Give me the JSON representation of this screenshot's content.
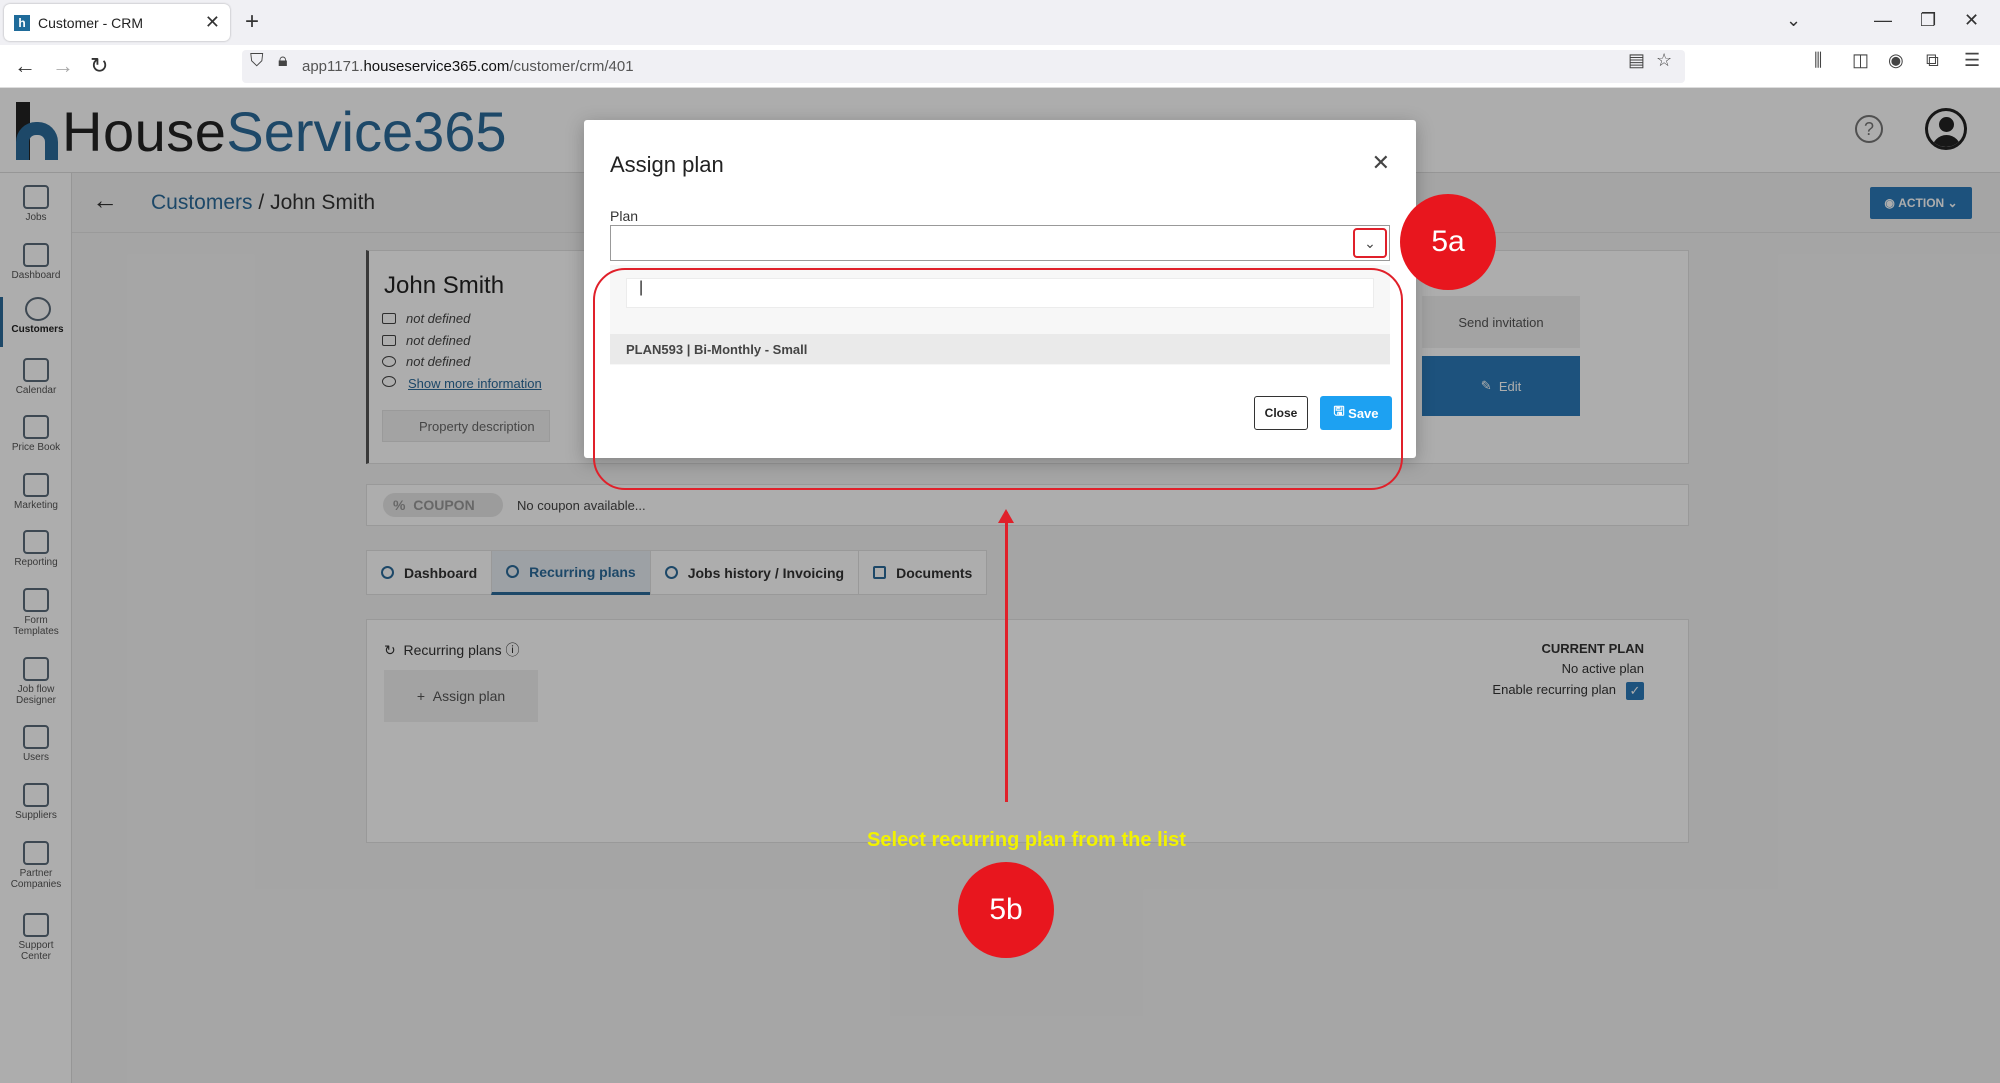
{
  "browser": {
    "tab_title": "Customer - CRM",
    "url_prefix": "app1171.",
    "url_host": "houseservice365.com",
    "url_path": "/customer/crm/401"
  },
  "app": {
    "logo_house": "House",
    "logo_service": "Service365"
  },
  "sidebar": {
    "items": [
      {
        "label": "Jobs",
        "icon": "tools-icon"
      },
      {
        "label": "Dashboard",
        "icon": "chart-icon"
      },
      {
        "label": "Customers",
        "icon": "target-icon"
      },
      {
        "label": "Calendar",
        "icon": "calendar-icon"
      },
      {
        "label": "Price Book",
        "icon": "pricebook-icon"
      },
      {
        "label": "Marketing",
        "icon": "tag-icon"
      },
      {
        "label": "Reporting",
        "icon": "report-icon"
      },
      {
        "label": "Form Templates",
        "icon": "form-icon"
      },
      {
        "label": "Job flow Designer",
        "icon": "flow-icon"
      },
      {
        "label": "Users",
        "icon": "users-icon"
      },
      {
        "label": "Suppliers",
        "icon": "truck-icon"
      },
      {
        "label": "Partner Companies",
        "icon": "partners-icon"
      },
      {
        "label": "Support Center",
        "icon": "support-icon"
      }
    ]
  },
  "breadcrumb": {
    "link": "Customers",
    "separator": "/",
    "current": "John Smith"
  },
  "action_button": "ACTION",
  "customer": {
    "name": "John Smith",
    "email": "not defined",
    "address": "not defined",
    "phone": "not defined",
    "show_more": "Show more information",
    "property_description": "Property description",
    "send_invitation": "Send invitation",
    "edit": "Edit"
  },
  "coupon": {
    "badge": "COUPON",
    "text": "No coupon available..."
  },
  "tabs": [
    {
      "label": "Dashboard",
      "active": false
    },
    {
      "label": "Recurring plans",
      "active": true
    },
    {
      "label": "Jobs history / Invoicing",
      "active": false
    },
    {
      "label": "Documents",
      "active": false
    }
  ],
  "recurring": {
    "title": "Recurring plans",
    "assign_button": "Assign plan",
    "current_plan_heading": "CURRENT PLAN",
    "current_plan_value": "No active plan",
    "enable_label": "Enable recurring plan",
    "enable_checked": true
  },
  "modal": {
    "title": "Assign plan",
    "plan_label": "Plan",
    "search_value": "|",
    "options": [
      "PLAN593 | Bi-Monthly - Small"
    ],
    "close_button": "Close",
    "save_button": "Save"
  },
  "annotations": {
    "step_a": "5a",
    "step_b": "5b",
    "note": "Select recurring plan from the list",
    "color_red": "#e8161e",
    "color_note": "#f2f200"
  }
}
